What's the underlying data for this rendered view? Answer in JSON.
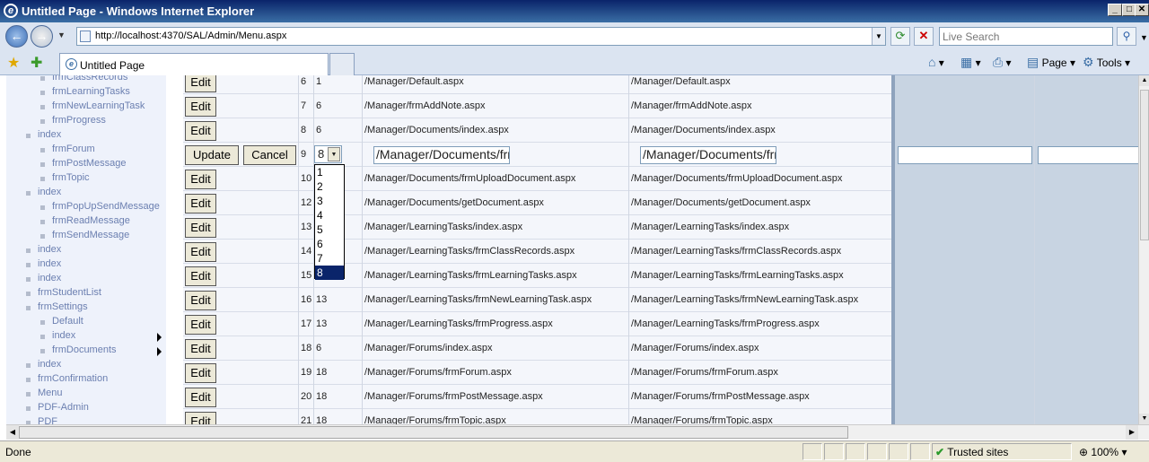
{
  "window": {
    "title": "Untitled Page - Windows Internet Explorer",
    "controls": [
      "_",
      "□",
      "✕"
    ]
  },
  "nav": {
    "url": "http://localhost:4370/SAL/Admin/Menu.aspx",
    "search_placeholder": "Live Search"
  },
  "tabs": {
    "active": "Untitled Page",
    "commands": {
      "page": "Page",
      "tools": "Tools"
    }
  },
  "tree": {
    "items": [
      "frmClassRecords",
      "frmLearningTasks",
      "frmNewLearningTask",
      "frmProgress",
      "index",
      "frmForum",
      "frmPostMessage",
      "frmTopic",
      "index",
      "frmPopUpSendMessage",
      "frmReadMessage",
      "frmSendMessage",
      "index",
      "index",
      "index",
      "frmStudentList",
      "frmSettings",
      "Default",
      "index",
      "frmDocuments",
      "index",
      "frmConfirmation",
      "Menu",
      "PDF-Admin",
      "PDF"
    ]
  },
  "grid": {
    "edit_label": "Edit",
    "update_label": "Update",
    "cancel_label": "Cancel",
    "rows": [
      {
        "id": "6",
        "parent": "1",
        "path": "/Manager/Default.aspx",
        "url": "/Manager/Default.aspx"
      },
      {
        "id": "7",
        "parent": "6",
        "path": "/Manager/frmAddNote.aspx",
        "url": "/Manager/frmAddNote.aspx"
      },
      {
        "id": "8",
        "parent": "6",
        "path": "/Manager/Documents/index.aspx",
        "url": "/Manager/Documents/index.aspx"
      },
      {
        "id": "9",
        "parent": "8",
        "path": "/Manager/Documents/frmI",
        "url": "/Manager/Documents/frmI",
        "editing": true
      },
      {
        "id": "10",
        "parent": "",
        "path": "/Manager/Documents/frmUploadDocument.aspx",
        "url": "/Manager/Documents/frmUploadDocument.aspx"
      },
      {
        "id": "12",
        "parent": "",
        "path": "/Manager/Documents/getDocument.aspx",
        "url": "/Manager/Documents/getDocument.aspx"
      },
      {
        "id": "13",
        "parent": "",
        "path": "/Manager/LearningTasks/index.aspx",
        "url": "/Manager/LearningTasks/index.aspx"
      },
      {
        "id": "14",
        "parent": "",
        "path": "/Manager/LearningTasks/frmClassRecords.aspx",
        "url": "/Manager/LearningTasks/frmClassRecords.aspx"
      },
      {
        "id": "15",
        "parent": "",
        "path": "/Manager/LearningTasks/frmLearningTasks.aspx",
        "url": "/Manager/LearningTasks/frmLearningTasks.aspx"
      },
      {
        "id": "16",
        "parent": "13",
        "path": "/Manager/LearningTasks/frmNewLearningTask.aspx",
        "url": "/Manager/LearningTasks/frmNewLearningTask.aspx"
      },
      {
        "id": "17",
        "parent": "13",
        "path": "/Manager/LearningTasks/frmProgress.aspx",
        "url": "/Manager/LearningTasks/frmProgress.aspx"
      },
      {
        "id": "18",
        "parent": "6",
        "path": "/Manager/Forums/index.aspx",
        "url": "/Manager/Forums/index.aspx"
      },
      {
        "id": "19",
        "parent": "18",
        "path": "/Manager/Forums/frmForum.aspx",
        "url": "/Manager/Forums/frmForum.aspx"
      },
      {
        "id": "20",
        "parent": "18",
        "path": "/Manager/Forums/frmPostMessage.aspx",
        "url": "/Manager/Forums/frmPostMessage.aspx"
      },
      {
        "id": "21",
        "parent": "18",
        "path": "/Manager/Forums/frmTopic.aspx",
        "url": "/Manager/Forums/frmTopic.aspx"
      }
    ],
    "dropdown": {
      "selected": "8",
      "options": [
        "1",
        "2",
        "3",
        "4",
        "5",
        "6",
        "7",
        "8"
      ]
    }
  },
  "status": {
    "text": "Done",
    "zone": "Trusted sites",
    "zoom": "100%"
  }
}
